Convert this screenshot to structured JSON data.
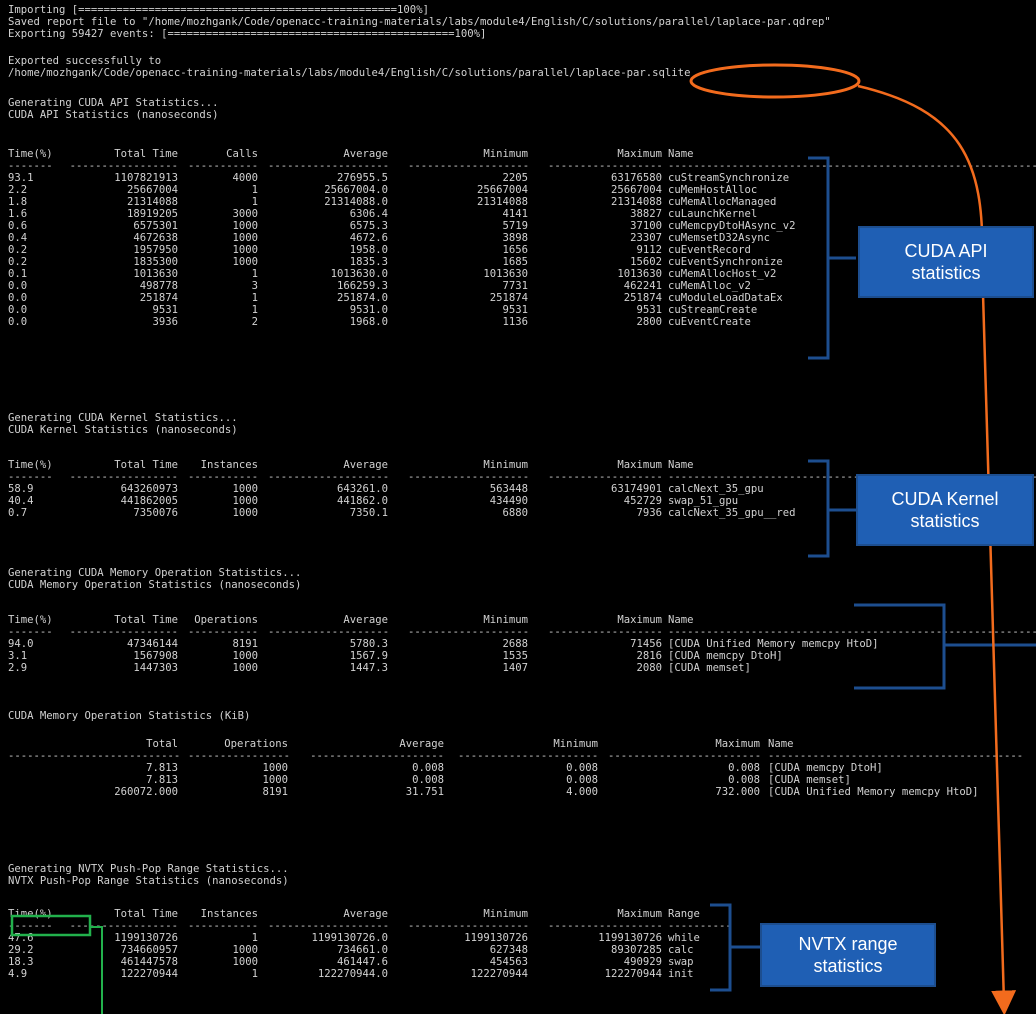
{
  "header_lines": [
    "Importing [==================================================100%]",
    "Saved report file to \"/home/mozhgank/Code/openacc-training-materials/labs/module4/English/C/solutions/parallel/laplace-par.qdrep\"",
    "Exporting 59427 events: [=============================================100%]",
    "",
    "Exported successfully to",
    "/home/mozhgank/Code/openacc-training-materials/labs/module4/English/C/solutions/parallel/laplace-par.sqlite"
  ],
  "api": {
    "gen": "Generating CUDA API Statistics...",
    "title": "CUDA API Statistics (nanoseconds)",
    "headers": [
      "Time(%)",
      "Total Time",
      "Calls",
      "Average",
      "Minimum",
      "Maximum",
      "Name"
    ],
    "rows": [
      [
        "93.1",
        "1107821913",
        "4000",
        "276955.5",
        "2205",
        "63176580",
        "cuStreamSynchronize"
      ],
      [
        "2.2",
        "25667004",
        "1",
        "25667004.0",
        "25667004",
        "25667004",
        "cuMemHostAlloc"
      ],
      [
        "1.8",
        "21314088",
        "1",
        "21314088.0",
        "21314088",
        "21314088",
        "cuMemAllocManaged"
      ],
      [
        "1.6",
        "18919205",
        "3000",
        "6306.4",
        "4141",
        "38827",
        "cuLaunchKernel"
      ],
      [
        "0.6",
        "6575301",
        "1000",
        "6575.3",
        "5719",
        "37100",
        "cuMemcpyDtoHAsync_v2"
      ],
      [
        "0.4",
        "4672638",
        "1000",
        "4672.6",
        "3898",
        "23307",
        "cuMemsetD32Async"
      ],
      [
        "0.2",
        "1957950",
        "1000",
        "1958.0",
        "1656",
        "9112",
        "cuEventRecord"
      ],
      [
        "0.2",
        "1835300",
        "1000",
        "1835.3",
        "1685",
        "15602",
        "cuEventSynchronize"
      ],
      [
        "0.1",
        "1013630",
        "1",
        "1013630.0",
        "1013630",
        "1013630",
        "cuMemAllocHost_v2"
      ],
      [
        "0.0",
        "498778",
        "3",
        "166259.3",
        "7731",
        "462241",
        "cuMemAlloc_v2"
      ],
      [
        "0.0",
        "251874",
        "1",
        "251874.0",
        "251874",
        "251874",
        "cuModuleLoadDataEx"
      ],
      [
        "0.0",
        "9531",
        "1",
        "9531.0",
        "9531",
        "9531",
        "cuStreamCreate"
      ],
      [
        "0.0",
        "3936",
        "2",
        "1968.0",
        "1136",
        "2800",
        "cuEventCreate"
      ]
    ]
  },
  "kernel": {
    "gen": "Generating CUDA Kernel Statistics...",
    "title": "CUDA Kernel Statistics (nanoseconds)",
    "headers": [
      "Time(%)",
      "Total Time",
      "Instances",
      "Average",
      "Minimum",
      "Maximum",
      "Name"
    ],
    "rows": [
      [
        "58.9",
        "643260973",
        "1000",
        "643261.0",
        "563448",
        "63174901",
        "calcNext_35_gpu"
      ],
      [
        "40.4",
        "441862005",
        "1000",
        "441862.0",
        "434490",
        "452729",
        "swap_51_gpu"
      ],
      [
        "0.7",
        "7350076",
        "1000",
        "7350.1",
        "6880",
        "7936",
        "calcNext_35_gpu__red"
      ]
    ]
  },
  "memop": {
    "gen": "Generating CUDA Memory Operation Statistics...",
    "title": "CUDA Memory Operation Statistics (nanoseconds)",
    "headers": [
      "Time(%)",
      "Total Time",
      "Operations",
      "Average",
      "Minimum",
      "Maximum",
      "Name"
    ],
    "rows": [
      [
        "94.0",
        "47346144",
        "8191",
        "5780.3",
        "2688",
        "71456",
        "[CUDA Unified Memory memcpy HtoD]"
      ],
      [
        "3.1",
        "1567908",
        "1000",
        "1567.9",
        "1535",
        "2816",
        "[CUDA memcpy DtoH]"
      ],
      [
        "2.9",
        "1447303",
        "1000",
        "1447.3",
        "1407",
        "2080",
        "[CUDA memset]"
      ]
    ]
  },
  "memkib": {
    "title": "CUDA Memory Operation Statistics (KiB)",
    "headers": [
      "Total",
      "Operations",
      "Average",
      "Minimum",
      "Maximum",
      "Name"
    ],
    "rows": [
      [
        "7.813",
        "1000",
        "0.008",
        "0.008",
        "0.008",
        "[CUDA memcpy DtoH]"
      ],
      [
        "7.813",
        "1000",
        "0.008",
        "0.008",
        "0.008",
        "[CUDA memset]"
      ],
      [
        "260072.000",
        "8191",
        "31.751",
        "4.000",
        "732.000",
        "[CUDA Unified Memory memcpy HtoD]"
      ]
    ]
  },
  "nvtx": {
    "gen": "Generating NVTX Push-Pop Range Statistics...",
    "title": "NVTX Push-Pop Range Statistics (nanoseconds)",
    "headers": [
      "Time(%)",
      "Total Time",
      "Instances",
      "Average",
      "Minimum",
      "Maximum",
      "Range"
    ],
    "rows": [
      [
        "47.6",
        "1199130726",
        "1",
        "1199130726.0",
        "1199130726",
        "1199130726",
        "while"
      ],
      [
        "29.2",
        "734660957",
        "1000",
        "734661.0",
        "627348",
        "89307285",
        "calc"
      ],
      [
        "18.3",
        "461447578",
        "1000",
        "461447.6",
        "454563",
        "490929",
        "swap"
      ],
      [
        "4.9",
        "122270944",
        "1",
        "122270944.0",
        "122270944",
        "122270944",
        "init"
      ]
    ]
  },
  "callouts": {
    "api": [
      "CUDA API",
      "statistics"
    ],
    "kernel": [
      "CUDA Kernel",
      "statistics"
    ],
    "nvtx": [
      "NVTX range",
      "statistics"
    ]
  },
  "colors": {
    "terminal_bg": "#000000",
    "terminal_fg": "#d2d2d2",
    "callout_bg": "#1f5fb4",
    "bracket": "#1d4e8f",
    "orange": "#f26b1d",
    "green": "#22b14c"
  }
}
